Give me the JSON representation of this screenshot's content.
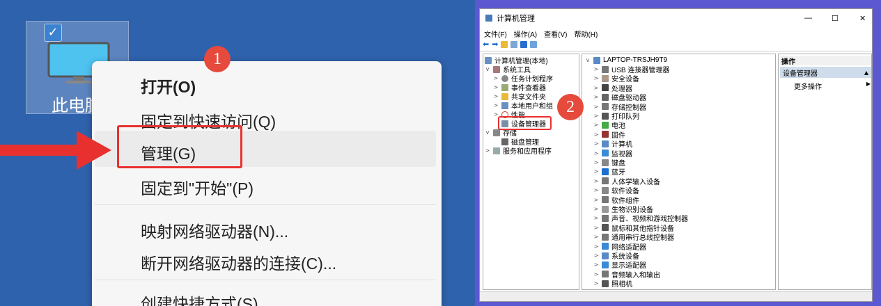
{
  "desktop": {
    "icon_label": "此电脑"
  },
  "context_menu": {
    "items": [
      "打开(O)",
      "固定到快速访问(Q)",
      "管理(G)",
      "固定到\"开始\"(P)",
      "映射网络驱动器(N)...",
      "断开网络驱动器的连接(C)...",
      "创建快捷方式(S)"
    ]
  },
  "badges": [
    "1",
    "2"
  ],
  "window": {
    "title": "计算机管理",
    "menubar": [
      "文件(F)",
      "操作(A)",
      "查看(V)",
      "帮助(H)"
    ],
    "controls": [
      "—",
      "☐",
      "✕"
    ]
  },
  "tree": {
    "root": "计算机管理(本地)",
    "system_tools": "系统工具",
    "system_children": [
      "任务计划程序",
      "事件查看器",
      "共享文件夹",
      "本地用户和组",
      "性能",
      "设备管理器"
    ],
    "storage": "存储",
    "storage_children": [
      "磁盘管理"
    ],
    "services": "服务和应用程序"
  },
  "devices": {
    "computer": "LAPTOP-TRSJH9T9",
    "items": [
      "USB 连接器管理器",
      "安全设备",
      "处理器",
      "磁盘驱动器",
      "存储控制器",
      "打印队列",
      "电池",
      "固件",
      "计算机",
      "监视器",
      "键盘",
      "蓝牙",
      "人体学输入设备",
      "软件设备",
      "软件组件",
      "生物识别设备",
      "声音、视频和游戏控制器",
      "鼠标和其他指针设备",
      "通用串行总线控制器",
      "网络适配器",
      "系统设备",
      "显示适配器",
      "音频输入和输出",
      "照相机"
    ]
  },
  "actions": {
    "header": "操作",
    "section": "设备管理器",
    "more": "更多操作"
  },
  "colors": {
    "desktop_blue": "#2f62ad",
    "highlight_red": "#e8312f",
    "badge_red": "#e54a3d",
    "right_bg": "#5b58d0"
  }
}
